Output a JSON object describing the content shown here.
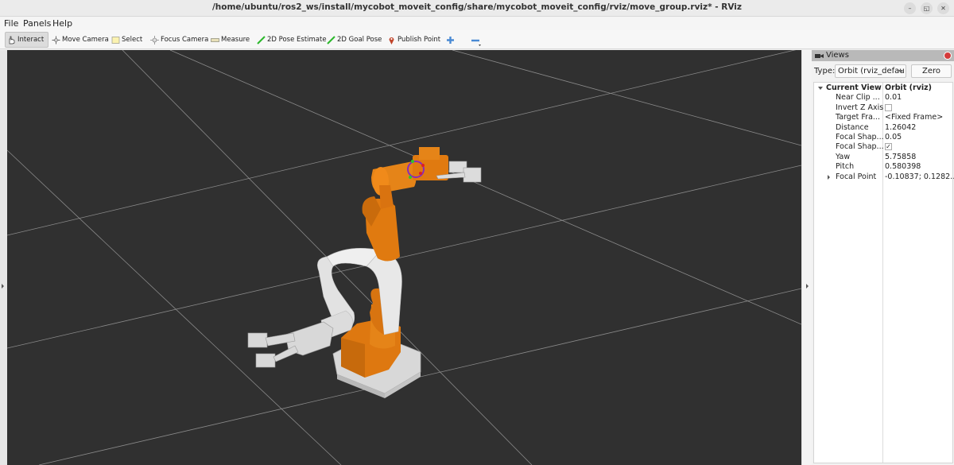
{
  "window": {
    "title": "/home/ubuntu/ros2_ws/install/mycobot_moveit_config/share/mycobot_moveit_config/rviz/move_group.rviz* - RViz",
    "controls": [
      "minimize",
      "restore",
      "close"
    ]
  },
  "menu": [
    {
      "label": "File",
      "mnemonic": "F"
    },
    {
      "label": "Panels",
      "mnemonic": "P"
    },
    {
      "label": "Help",
      "mnemonic": "H"
    }
  ],
  "toolbar": {
    "tools": [
      {
        "label": "Interact",
        "icon": "hand-pointer-icon",
        "active": true
      },
      {
        "label": "Move Camera",
        "icon": "move-camera-icon",
        "active": false
      },
      {
        "label": "Select",
        "icon": "select-box-icon",
        "active": false
      },
      {
        "label": "Focus Camera",
        "icon": "focus-camera-icon",
        "active": false
      },
      {
        "label": "Measure",
        "icon": "ruler-icon",
        "active": false
      },
      {
        "label": "2D Pose Estimate",
        "icon": "green-arrow-icon",
        "active": false
      },
      {
        "label": "2D Goal Pose",
        "icon": "green-arrow-icon",
        "active": false
      },
      {
        "label": "Publish Point",
        "icon": "map-pin-icon",
        "active": false
      }
    ],
    "add_tool_icon": "plus-icon",
    "remove_tool_icon": "minus-icon"
  },
  "viewport": {
    "background": "#303030",
    "grid_color": "#a0a0a0",
    "robot_colors": {
      "orange": "#e07a10",
      "white": "#e4e4e4"
    }
  },
  "views_panel": {
    "title": "Views",
    "type_label": "Type:",
    "type_value": "Orbit (rviz_defau",
    "zero_label": "Zero",
    "tree": {
      "header": {
        "key": "Current View",
        "value": "Orbit (rviz)"
      },
      "rows": [
        {
          "key": "Near Clip ...",
          "value": "0.01"
        },
        {
          "key": "Invert Z Axis",
          "value": "",
          "checkbox": false
        },
        {
          "key": "Target Fra...",
          "value": "<Fixed Frame>"
        },
        {
          "key": "Distance",
          "value": "1.26042"
        },
        {
          "key": "Focal Shap...",
          "value": "0.05"
        },
        {
          "key": "Focal Shap...",
          "value": "✓",
          "checkbox": true
        },
        {
          "key": "Yaw",
          "value": "5.75858"
        },
        {
          "key": "Pitch",
          "value": "0.580398"
        },
        {
          "key": "Focal Point",
          "value": "-0.10837; 0.1282…",
          "expandable": true
        }
      ]
    }
  }
}
